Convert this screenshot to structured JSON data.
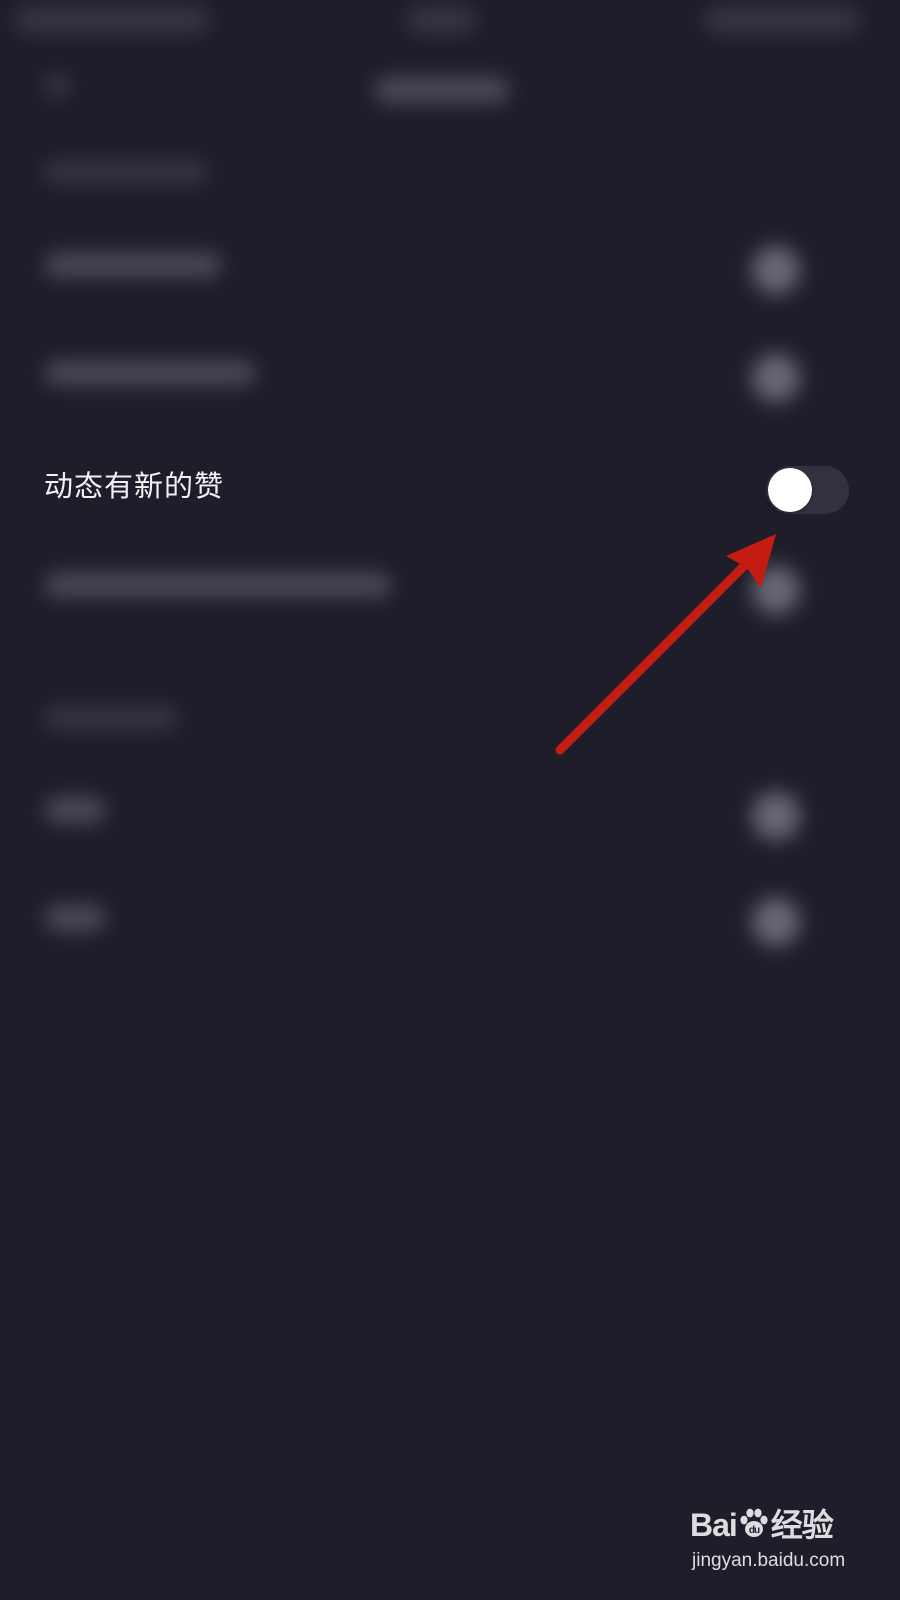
{
  "setting": {
    "label": "动态有新的赞",
    "toggle_on": false
  },
  "colors": {
    "background": "#1f1d2a",
    "toggle_track": "#33313e",
    "toggle_knob": "#ffffff",
    "annotation_arrow": "#c41c12"
  },
  "icons": {
    "watermark_paw": "paw-icon"
  },
  "watermark": {
    "logo_left": "Bai",
    "logo_right": "经验",
    "url": "jingyan.baidu.com"
  }
}
